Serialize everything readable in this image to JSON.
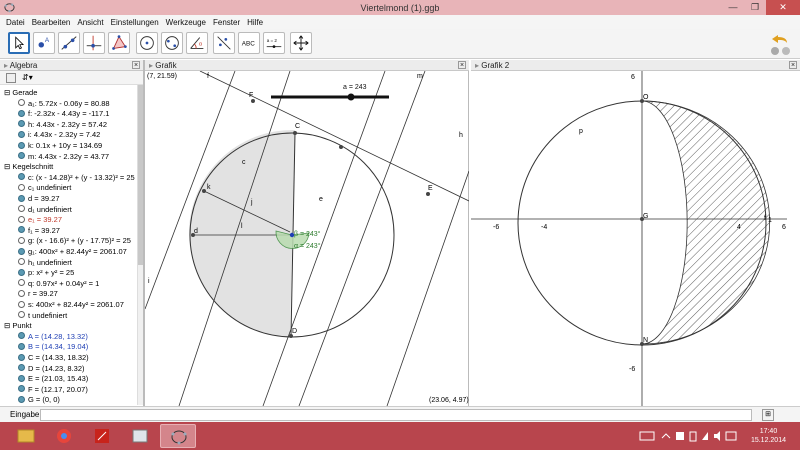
{
  "window": {
    "title": "Viertelmond (1).ggb",
    "minimize": "—",
    "maximize": "❐",
    "close": "✕"
  },
  "menu": [
    "Datei",
    "Bearbeiten",
    "Ansicht",
    "Einstellungen",
    "Werkzeuge",
    "Fenster",
    "Hilfe"
  ],
  "tools": [
    {
      "name": "move-tool"
    },
    {
      "name": "point-tool",
      "label": "A"
    },
    {
      "name": "line-tool"
    },
    {
      "name": "perpendicular-tool"
    },
    {
      "name": "polygon-tool"
    },
    {
      "name": "circle-tool"
    },
    {
      "name": "conic-tool"
    },
    {
      "name": "angle-tool",
      "label": "α"
    },
    {
      "name": "reflect-tool"
    },
    {
      "name": "text-tool",
      "label": "ABC"
    },
    {
      "name": "slider-tool",
      "label": "a = 2"
    },
    {
      "name": "move-graphics-tool"
    }
  ],
  "algebra": {
    "title": "Algebra",
    "rows": [
      {
        "type": "cat",
        "text": "Gerade"
      },
      {
        "type": "item",
        "dot": "hollow",
        "text": "a₁: 5.72x - 0.06y = 80.88"
      },
      {
        "type": "item",
        "dot": "filled",
        "text": "f: -2.32x - 4.43y = -117.1"
      },
      {
        "type": "item",
        "dot": "filled",
        "text": "h: 4.43x - 2.32y = 57.42"
      },
      {
        "type": "item",
        "dot": "filled",
        "text": "i: 4.43x - 2.32y = 7.42"
      },
      {
        "type": "item",
        "dot": "filled",
        "text": "k: 0.1x + 10y = 134.69"
      },
      {
        "type": "item",
        "dot": "filled",
        "text": "m: 4.43x - 2.32y = 43.77"
      },
      {
        "type": "cat",
        "text": "Kegelschnitt"
      },
      {
        "type": "item",
        "dot": "filled",
        "text": "c: (x - 14.28)² + (y - 13.32)² = 25"
      },
      {
        "type": "item",
        "dot": "hollow",
        "text": "c₁ undefiniert"
      },
      {
        "type": "item",
        "dot": "filled",
        "text": "d = 39.27"
      },
      {
        "type": "item",
        "dot": "hollow",
        "text": "d₁ undefiniert"
      },
      {
        "type": "item",
        "dot": "hollow",
        "text": "e₁ = 39.27",
        "color": "#c0392b"
      },
      {
        "type": "item",
        "dot": "filled",
        "text": "f₁ = 39.27"
      },
      {
        "type": "item",
        "dot": "hollow",
        "text": "g: (x - 16.6)² + (y - 17.75)² = 25"
      },
      {
        "type": "item",
        "dot": "filled",
        "text": "g₁: 400x² + 82.44y² = 2061.07"
      },
      {
        "type": "item",
        "dot": "hollow",
        "text": "h₁ undefiniert"
      },
      {
        "type": "item",
        "dot": "filled",
        "text": "p: x² + y² = 25"
      },
      {
        "type": "item",
        "dot": "hollow",
        "text": "q: 0.97x² + 0.04y² = 1"
      },
      {
        "type": "item",
        "dot": "hollow",
        "text": "r = 39.27"
      },
      {
        "type": "item",
        "dot": "hollow",
        "text": "s: 400x² + 82.44y² = 2061.07"
      },
      {
        "type": "item",
        "dot": "hollow",
        "text": "t undefiniert"
      },
      {
        "type": "cat",
        "text": "Punkt"
      },
      {
        "type": "item",
        "dot": "filled",
        "text": "A = (14.28, 13.32)",
        "color": "#1f3fb5"
      },
      {
        "type": "item",
        "dot": "filled",
        "text": "B = (14.34, 19.04)",
        "color": "#1f3fb5"
      },
      {
        "type": "item",
        "dot": "filled",
        "text": "C = (14.33, 18.32)"
      },
      {
        "type": "item",
        "dot": "filled",
        "text": "D = (14.23, 8.32)"
      },
      {
        "type": "item",
        "dot": "filled",
        "text": "E = (21.03, 15.43)"
      },
      {
        "type": "item",
        "dot": "filled",
        "text": "F = (12.17, 20.07)"
      },
      {
        "type": "item",
        "dot": "filled",
        "text": "G = (0, 0)"
      }
    ]
  },
  "graphic1": {
    "title": "Grafik",
    "corner_tl": "(7, 21.59)",
    "corner_br": "(23.06, 4.97)",
    "slider_label": "a = 243",
    "angle_beta": "β = 243°",
    "angle_alpha": "α = 243°",
    "labels": {
      "f": "f",
      "F": "F",
      "m": "m",
      "C": "C",
      "h": "h",
      "c": "c",
      "E": "E",
      "e": "e",
      "j": "j",
      "l": "l",
      "d": "d",
      "i": "i",
      "D": "D",
      "k": "k"
    }
  },
  "graphic2": {
    "title": "Grafik 2",
    "labels": {
      "O": "O",
      "p": "p",
      "G": "G",
      "N": "N",
      "f1": "f",
      "f1_sub": "1"
    },
    "ticks": {
      "x_neg6": "-6",
      "x_neg4": "-4",
      "x_4": "4",
      "x_6": "6",
      "y_6": "6",
      "y_neg6": "-6"
    }
  },
  "input": {
    "label": "Eingabe:",
    "value": ""
  },
  "taskbar": {
    "time": "17:40",
    "date": "15.12.2014"
  }
}
